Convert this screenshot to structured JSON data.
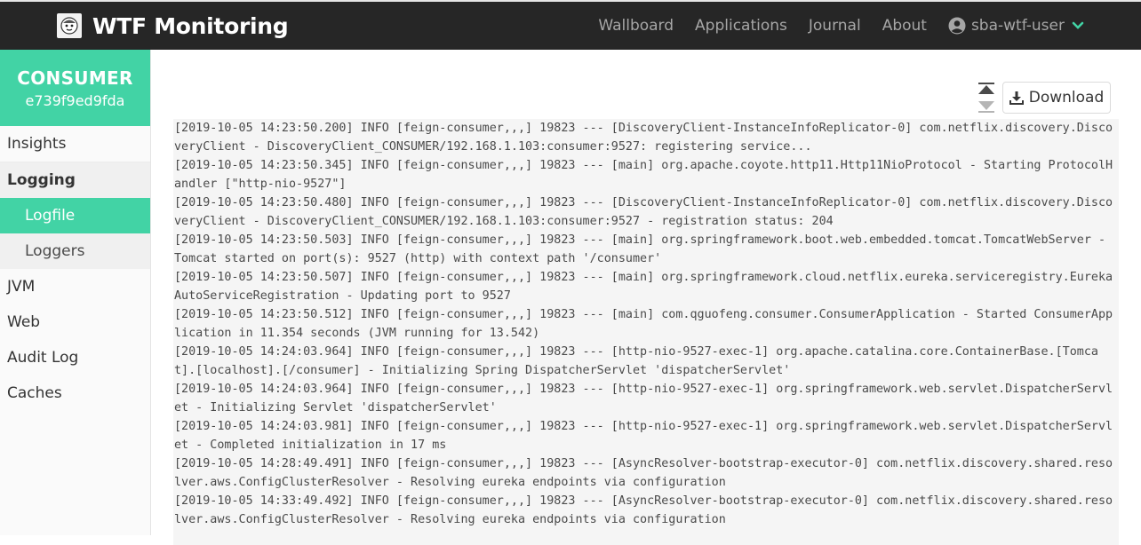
{
  "navbar": {
    "brand": "WTF Monitoring",
    "links": [
      "Wallboard",
      "Applications",
      "Journal",
      "About"
    ],
    "user": "sba-wtf-user"
  },
  "sidebar": {
    "instance_name": "CONSUMER",
    "instance_id": "e739f9ed9fda",
    "items": {
      "insights": "Insights",
      "logging": "Logging",
      "logfile": "Logfile",
      "loggers": "Loggers",
      "jvm": "JVM",
      "web": "Web",
      "audit_log": "Audit Log",
      "caches": "Caches"
    }
  },
  "main": {
    "download_label": "Download",
    "log_lines": [
      "[2019-10-05 14:23:50.200] INFO [feign-consumer,,,] 19823 --- [DiscoveryClient-InstanceInfoReplicator-0] com.netflix.discovery.DiscoveryClient - DiscoveryClient_CONSUMER/192.168.1.103:consumer:9527: registering service...",
      "[2019-10-05 14:23:50.345] INFO [feign-consumer,,,] 19823 --- [main] org.apache.coyote.http11.Http11NioProtocol - Starting ProtocolHandler [\"http-nio-9527\"]",
      "[2019-10-05 14:23:50.480] INFO [feign-consumer,,,] 19823 --- [DiscoveryClient-InstanceInfoReplicator-0] com.netflix.discovery.DiscoveryClient - DiscoveryClient_CONSUMER/192.168.1.103:consumer:9527 - registration status: 204",
      "[2019-10-05 14:23:50.503] INFO [feign-consumer,,,] 19823 --- [main] org.springframework.boot.web.embedded.tomcat.TomcatWebServer - Tomcat started on port(s): 9527 (http) with context path '/consumer'",
      "[2019-10-05 14:23:50.507] INFO [feign-consumer,,,] 19823 --- [main] org.springframework.cloud.netflix.eureka.serviceregistry.EurekaAutoServiceRegistration - Updating port to 9527",
      "[2019-10-05 14:23:50.512] INFO [feign-consumer,,,] 19823 --- [main] com.qguofeng.consumer.ConsumerApplication - Started ConsumerApplication in 11.354 seconds (JVM running for 13.542)",
      "[2019-10-05 14:24:03.964] INFO [feign-consumer,,,] 19823 --- [http-nio-9527-exec-1] org.apache.catalina.core.ContainerBase.[Tomcat].[localhost].[/consumer] - Initializing Spring DispatcherServlet 'dispatcherServlet'",
      "[2019-10-05 14:24:03.964] INFO [feign-consumer,,,] 19823 --- [http-nio-9527-exec-1] org.springframework.web.servlet.DispatcherServlet - Initializing Servlet 'dispatcherServlet'",
      "[2019-10-05 14:24:03.981] INFO [feign-consumer,,,] 19823 --- [http-nio-9527-exec-1] org.springframework.web.servlet.DispatcherServlet - Completed initialization in 17 ms",
      "[2019-10-05 14:28:49.491] INFO [feign-consumer,,,] 19823 --- [AsyncResolver-bootstrap-executor-0] com.netflix.discovery.shared.resolver.aws.ConfigClusterResolver - Resolving eureka endpoints via configuration",
      "[2019-10-05 14:33:49.492] INFO [feign-consumer,,,] 19823 --- [AsyncResolver-bootstrap-executor-0] com.netflix.discovery.shared.resolver.aws.ConfigClusterResolver - Resolving eureka endpoints via configuration"
    ]
  }
}
